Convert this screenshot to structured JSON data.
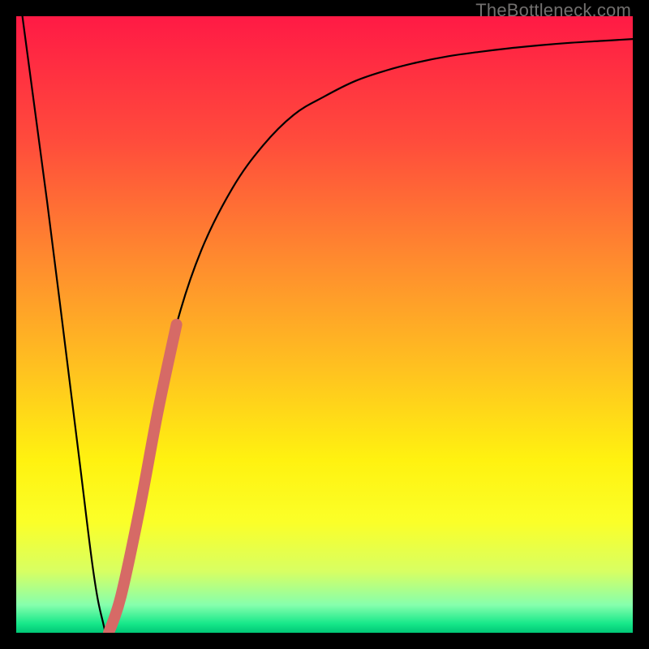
{
  "watermark": "TheBottleneck.com",
  "colors": {
    "frame": "#000000",
    "curve": "#000000",
    "highlight": "#d66a66",
    "gradient_stops": [
      {
        "offset": 0.0,
        "color": "#ff1a45"
      },
      {
        "offset": 0.2,
        "color": "#ff4b3c"
      },
      {
        "offset": 0.4,
        "color": "#ff8c2e"
      },
      {
        "offset": 0.58,
        "color": "#ffc41f"
      },
      {
        "offset": 0.72,
        "color": "#fff210"
      },
      {
        "offset": 0.82,
        "color": "#fbff28"
      },
      {
        "offset": 0.9,
        "color": "#d8ff62"
      },
      {
        "offset": 0.955,
        "color": "#86ffad"
      },
      {
        "offset": 0.985,
        "color": "#17e88a"
      },
      {
        "offset": 1.0,
        "color": "#00c776"
      }
    ]
  },
  "chart_data": {
    "type": "line",
    "title": "",
    "xlabel": "",
    "ylabel": "",
    "xlim": [
      0,
      100
    ],
    "ylim": [
      0,
      100
    ],
    "series": [
      {
        "name": "bottleneck-curve",
        "x": [
          1,
          5,
          10,
          12.5,
          14,
          15,
          17,
          20,
          23,
          26,
          30,
          35,
          40,
          45,
          50,
          55,
          60,
          65,
          70,
          75,
          80,
          85,
          90,
          95,
          100
        ],
        "values": [
          100,
          70,
          30,
          10,
          2,
          0,
          6,
          20,
          36,
          50,
          62,
          72,
          79,
          84,
          87,
          89.5,
          91.2,
          92.5,
          93.5,
          94.2,
          94.8,
          95.3,
          95.7,
          96.0,
          96.3
        ]
      }
    ],
    "highlight_segment": {
      "series": "bottleneck-curve",
      "x_start": 15,
      "x_end": 26,
      "note": "thick reddish overlay on rising limb"
    },
    "annotations": []
  }
}
